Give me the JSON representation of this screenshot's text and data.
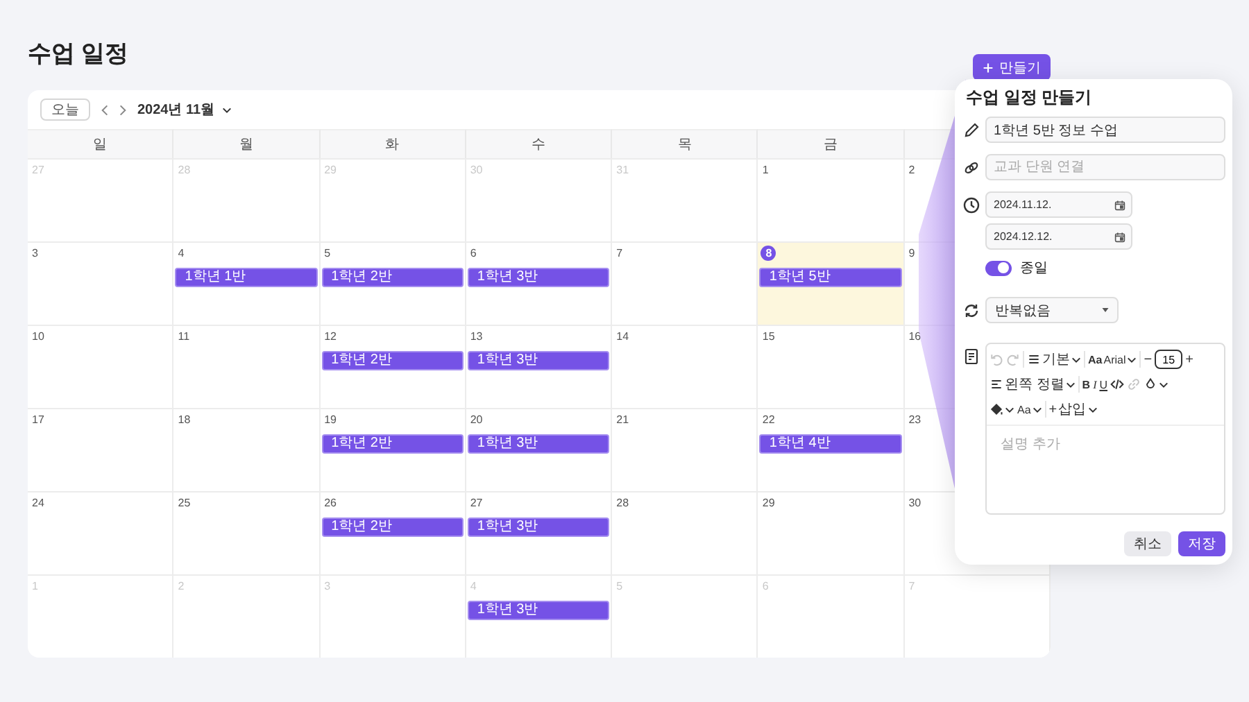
{
  "page": {
    "title": "수업 일정",
    "create_button": "만들기"
  },
  "calendar": {
    "today_button": "오늘",
    "month_label": "2024년 11월",
    "weekdays": [
      "일",
      "월",
      "화",
      "수",
      "목",
      "금"
    ],
    "weeks": [
      [
        {
          "day": "27",
          "outside": true,
          "today": false
        },
        {
          "day": "28",
          "outside": true,
          "today": false
        },
        {
          "day": "29",
          "outside": true,
          "today": false
        },
        {
          "day": "30",
          "outside": true,
          "today": false
        },
        {
          "day": "31",
          "outside": true,
          "today": false
        },
        {
          "day": "1",
          "outside": false,
          "today": false
        },
        {
          "day": "2",
          "outside": false,
          "today": false
        }
      ],
      [
        {
          "day": "3",
          "outside": false,
          "today": false
        },
        {
          "day": "4",
          "outside": false,
          "today": false,
          "events": [
            "1학년 1반"
          ]
        },
        {
          "day": "5",
          "outside": false,
          "today": false,
          "events": [
            "1학년 2반"
          ]
        },
        {
          "day": "6",
          "outside": false,
          "today": false,
          "events": [
            "1학년 3반"
          ]
        },
        {
          "day": "7",
          "outside": false,
          "today": false
        },
        {
          "day": "8",
          "outside": false,
          "today": true,
          "events": [
            "1학년 5반"
          ]
        },
        {
          "day": "9",
          "outside": false,
          "today": false
        }
      ],
      [
        {
          "day": "10",
          "outside": false,
          "today": false
        },
        {
          "day": "11",
          "outside": false,
          "today": false
        },
        {
          "day": "12",
          "outside": false,
          "today": false,
          "events": [
            "1학년 2반"
          ]
        },
        {
          "day": "13",
          "outside": false,
          "today": false,
          "events": [
            "1학년 3반"
          ]
        },
        {
          "day": "14",
          "outside": false,
          "today": false
        },
        {
          "day": "15",
          "outside": false,
          "today": false
        },
        {
          "day": "16",
          "outside": false,
          "today": false
        }
      ],
      [
        {
          "day": "17",
          "outside": false,
          "today": false
        },
        {
          "day": "18",
          "outside": false,
          "today": false
        },
        {
          "day": "19",
          "outside": false,
          "today": false,
          "events": [
            "1학년 2반"
          ]
        },
        {
          "day": "20",
          "outside": false,
          "today": false,
          "events": [
            "1학년 3반"
          ]
        },
        {
          "day": "21",
          "outside": false,
          "today": false
        },
        {
          "day": "22",
          "outside": false,
          "today": false,
          "events": [
            "1학년 4반"
          ]
        },
        {
          "day": "23",
          "outside": false,
          "today": false
        }
      ],
      [
        {
          "day": "24",
          "outside": false,
          "today": false
        },
        {
          "day": "25",
          "outside": false,
          "today": false
        },
        {
          "day": "26",
          "outside": false,
          "today": false,
          "events": [
            "1학년 2반"
          ]
        },
        {
          "day": "27",
          "outside": false,
          "today": false,
          "events": [
            "1학년 3반"
          ]
        },
        {
          "day": "28",
          "outside": false,
          "today": false
        },
        {
          "day": "29",
          "outside": false,
          "today": false
        },
        {
          "day": "30",
          "outside": false,
          "today": false
        }
      ],
      [
        {
          "day": "1",
          "outside": true,
          "today": false
        },
        {
          "day": "2",
          "outside": true,
          "today": false
        },
        {
          "day": "3",
          "outside": true,
          "today": false
        },
        {
          "day": "4",
          "outside": true,
          "today": false,
          "events": [
            "1학년 3반"
          ]
        },
        {
          "day": "5",
          "outside": true,
          "today": false
        },
        {
          "day": "6",
          "outside": true,
          "today": false
        },
        {
          "day": "7",
          "outside": true,
          "today": false
        }
      ]
    ]
  },
  "panel": {
    "title": "수업 일정 만들기",
    "title_field": {
      "value": "1학년 5반 정보 수업"
    },
    "link_field": {
      "placeholder": "교과 단원 연결"
    },
    "start_date": "2024.11.12.",
    "end_date": "2024.12.12.",
    "all_day": {
      "label": "종일",
      "on": true
    },
    "repeat": "반복없음",
    "editor": {
      "toolbar": [
        [
          {
            "kind": "undo",
            "disabled": true
          },
          {
            "kind": "redo",
            "disabled": true
          },
          {
            "kind": "sep"
          },
          {
            "kind": "block",
            "label": "기본",
            "dropdown": true
          },
          {
            "kind": "sep"
          },
          {
            "kind": "font",
            "prefix": "Aa",
            "label": "Arial",
            "dropdown": true
          },
          {
            "kind": "sep"
          },
          {
            "kind": "size",
            "minus": "−",
            "value": "15",
            "plus": "+"
          }
        ],
        [
          {
            "kind": "align",
            "label": "왼쪽 정렬",
            "dropdown": true
          },
          {
            "kind": "sep"
          },
          {
            "kind": "bold",
            "label": "B"
          },
          {
            "kind": "italic",
            "label": "I"
          },
          {
            "kind": "underline",
            "label": "U"
          },
          {
            "kind": "code"
          },
          {
            "kind": "link",
            "disabled": true
          },
          {
            "kind": "color",
            "dropdown": true
          }
        ],
        [
          {
            "kind": "fill",
            "dropdown": true
          },
          {
            "kind": "case",
            "label": "Aa",
            "dropdown": true
          },
          {
            "kind": "sep"
          },
          {
            "kind": "insert",
            "prefix": "+",
            "label": "삽입",
            "dropdown": true
          }
        ]
      ],
      "placeholder": "설명 추가"
    },
    "cancel_button": "취소",
    "save_button": "저장"
  }
}
